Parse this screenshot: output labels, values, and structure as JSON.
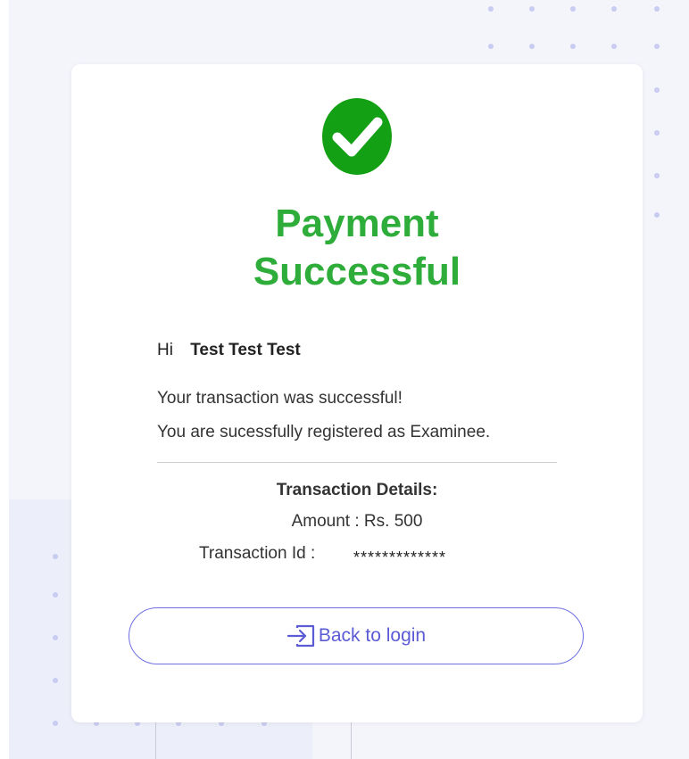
{
  "icons": {
    "success": "check-circle-icon",
    "back": "login-enter-icon"
  },
  "colors": {
    "success": "#2fad3a",
    "accent": "#5b5bd6"
  },
  "title": "Payment\nSuccessful",
  "greeting": {
    "hi": "Hi",
    "name": "Test Test Test"
  },
  "messages": {
    "line1": "Your transaction was successful!",
    "line2": "You are sucessfully registered as Examinee."
  },
  "transaction": {
    "heading": "Transaction Details:",
    "amount": "Amount : Rs. 500",
    "id_label": "Transaction Id :",
    "id_value": "*************"
  },
  "button": {
    "back_label": "Back to login"
  }
}
